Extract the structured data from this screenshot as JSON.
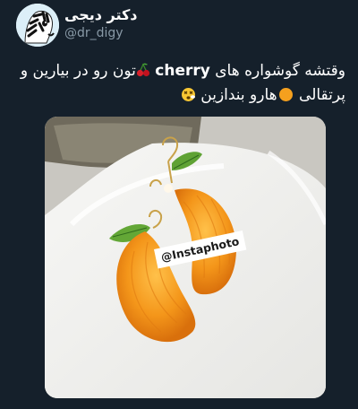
{
  "tweet": {
    "author": {
      "display_name": "دکتر دیجی",
      "handle": "@dr_digy",
      "avatar_icon": "zebra-avatar-icon"
    },
    "text": {
      "line1_part1": "وقتشه گوشواره های ",
      "line1_keyword": "cherry",
      "line1_part2": "تون رو در بیارین و",
      "line2_part1": "پرتقالی ",
      "line2_part2": "هارو بندازین"
    },
    "emojis": [
      "cherries-emoji",
      "orange-emoji",
      "dizzy-face-emoji"
    ],
    "photo": {
      "watermark": "@Instaphoto"
    }
  },
  "colors": {
    "background": "#15202b",
    "text": "#ffffff",
    "secondary_text": "#8899a6",
    "orange": "#f39a1c"
  }
}
